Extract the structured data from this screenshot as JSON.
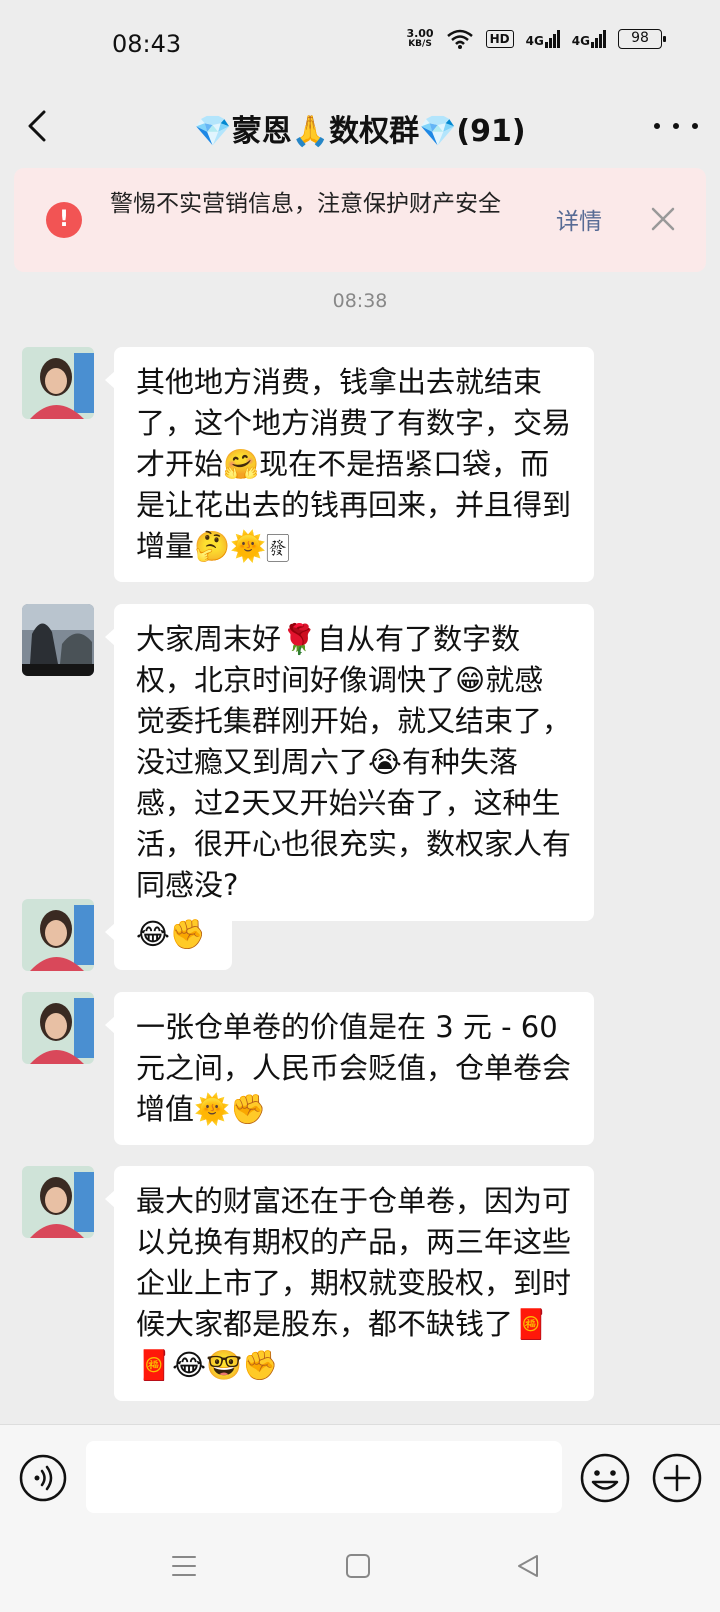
{
  "status_bar": {
    "time": "08:43",
    "net_speed_value": "3.00",
    "net_speed_unit": "KB/S",
    "hd_label": "HD",
    "signal1_label": "4G",
    "signal2_label": "4G",
    "battery": "98"
  },
  "nav": {
    "title": "💎蒙恩🙏数权群💎(91)"
  },
  "warning": {
    "text": "警惕不实营销信息，注意保护财产安全",
    "detail_label": "详情"
  },
  "time_divider": "08:38",
  "messages": [
    {
      "text": "其他地方消费，钱拿出去就结束了，这个地方消费了有数字，交易才开始🤗现在不是捂紧口袋，而是让花出去的钱再回来，并且得到增量🤔🌞🀅"
    },
    {
      "text": "大家周末好🌹自从有了数字数权，北京时间好像调快了😁就感觉委托集群刚开始，就又结束了，没过瘾又到周六了😭有种失落感，过2天又开始兴奋了，这种生活，很开心也很充实，数权家人有同感没?"
    },
    {
      "text": "😂✊"
    },
    {
      "text": "一张仓单卷的价值是在 3 元 - 60 元之间，人民币会贬值，仓单卷会增值🌞✊"
    },
    {
      "text": "最大的财富还在于仓单卷，因为可以兑换有期权的产品，两三年这些企业上市了，期权就变股权，到时候大家都是股东，都不缺钱了🧧🧧😂🤓✊"
    }
  ],
  "icons": {
    "back": "back-arrow-icon",
    "more": "more-icon",
    "warning": "exclamation-icon",
    "close": "close-icon",
    "voice": "voice-icon",
    "emoji": "emoji-icon",
    "plus": "plus-icon",
    "menu": "menu-icon",
    "home": "home-icon",
    "back_nav": "back-triangle-icon"
  },
  "colors": {
    "background": "#ededed",
    "warning_bg": "#fbe9e9",
    "warning_icon": "#f25454",
    "link": "#576b95"
  }
}
